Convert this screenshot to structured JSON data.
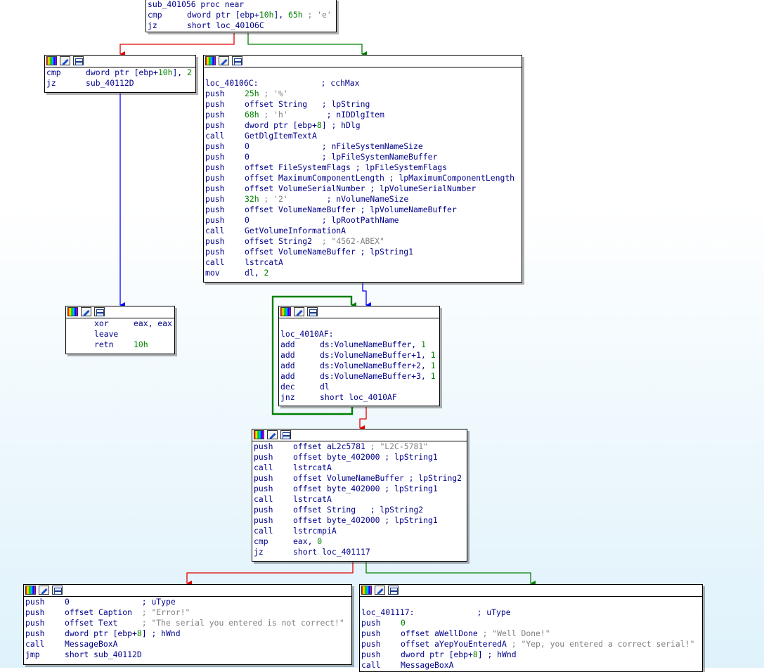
{
  "blocks": {
    "b1": {
      "lines": [
        {
          "label": "sub_401056 proc near"
        },
        {
          "mn": "cmp",
          "ops": "dword ptr [ebp+10h], 65h",
          "cmt": "; 'e'"
        },
        {
          "mn": "jz",
          "ops": "short loc_40106C"
        }
      ]
    },
    "b2": {
      "lines": [
        {
          "mn": "cmp",
          "ops": "dword ptr [ebp+10h], 2"
        },
        {
          "mn": "jz",
          "ops": "sub_40112D"
        }
      ]
    },
    "b3": {
      "lines": [
        {
          "label": "loc_40106C:             ; cchMax"
        },
        {
          "mn": "push",
          "ops": "25h",
          "cmt": "; '%'"
        },
        {
          "mn": "push",
          "ops": "offset String   ; lpString"
        },
        {
          "mn": "push",
          "ops": "68h",
          "cmt": "; 'h'",
          "tail": "        ; nIDDlgItem"
        },
        {
          "mn": "push",
          "ops": "dword ptr [ebp+8] ; hDlg"
        },
        {
          "mn": "call",
          "ops": "GetDlgItemTextA"
        },
        {
          "mn": "push",
          "ops": "0               ; nFileSystemNameSize"
        },
        {
          "mn": "push",
          "ops": "0               ; lpFileSystemNameBuffer"
        },
        {
          "mn": "push",
          "ops": "offset FileSystemFlags ; lpFileSystemFlags"
        },
        {
          "mn": "push",
          "ops": "offset MaximumComponentLength ; lpMaximumComponentLength"
        },
        {
          "mn": "push",
          "ops": "offset VolumeSerialNumber ; lpVolumeSerialNumber"
        },
        {
          "mn": "push",
          "ops": "32h",
          "cmt": "; '2'",
          "tail": "        ; nVolumeNameSize"
        },
        {
          "mn": "push",
          "ops": "offset VolumeNameBuffer ; lpVolumeNameBuffer"
        },
        {
          "mn": "push",
          "ops": "0               ; lpRootPathName"
        },
        {
          "mn": "call",
          "ops": "GetVolumeInformationA"
        },
        {
          "mn": "push",
          "ops": "offset String2  ",
          "cmt": "; \"4562-ABEX\""
        },
        {
          "mn": "push",
          "ops": "offset VolumeNameBuffer ; lpString1"
        },
        {
          "mn": "call",
          "ops": "lstrcatA"
        },
        {
          "mn": "mov",
          "ops": "dl, 2"
        }
      ]
    },
    "b4": {
      "lines": [
        {
          "mn": "xor",
          "ops": "eax, eax"
        },
        {
          "mn": "leave",
          "ops": ""
        },
        {
          "mn": "retn",
          "ops": "10h"
        }
      ]
    },
    "b5": {
      "lines": [
        {
          "label": "loc_4010AF:"
        },
        {
          "mn": "add",
          "ops": "ds:VolumeNameBuffer, 1"
        },
        {
          "mn": "add",
          "ops": "ds:VolumeNameBuffer+1, 1"
        },
        {
          "mn": "add",
          "ops": "ds:VolumeNameBuffer+2, 1"
        },
        {
          "mn": "add",
          "ops": "ds:VolumeNameBuffer+3, 1"
        },
        {
          "mn": "dec",
          "ops": "dl"
        },
        {
          "mn": "jnz",
          "ops": "short loc_4010AF"
        }
      ]
    },
    "b6": {
      "lines": [
        {
          "mn": "push",
          "ops": "offset aL2c5781 ",
          "cmt": "; \"L2C-5781\""
        },
        {
          "mn": "push",
          "ops": "offset byte_402000 ; lpString1"
        },
        {
          "mn": "call",
          "ops": "lstrcatA"
        },
        {
          "mn": "push",
          "ops": "offset VolumeNameBuffer ; lpString2"
        },
        {
          "mn": "push",
          "ops": "offset byte_402000 ; lpString1"
        },
        {
          "mn": "call",
          "ops": "lstrcatA"
        },
        {
          "mn": "push",
          "ops": "offset String   ; lpString2"
        },
        {
          "mn": "push",
          "ops": "offset byte_402000 ; lpString1"
        },
        {
          "mn": "call",
          "ops": "lstrcmpiA"
        },
        {
          "mn": "cmp",
          "ops": "eax, 0"
        },
        {
          "mn": "jz",
          "ops": "short loc_401117"
        }
      ]
    },
    "b7": {
      "lines": [
        {
          "mn": "push",
          "ops": "0               ; uType"
        },
        {
          "mn": "push",
          "ops": "offset Caption  ",
          "cmt": "; \"Error!\""
        },
        {
          "mn": "push",
          "ops": "offset Text     ",
          "cmt": "; \"The serial you entered is not correct!\""
        },
        {
          "mn": "push",
          "ops": "dword ptr [ebp+8] ; hWnd"
        },
        {
          "mn": "call",
          "ops": "MessageBoxA"
        },
        {
          "mn": "jmp",
          "ops": "short sub_40112D"
        }
      ]
    },
    "b8": {
      "lines": [
        {
          "label": "loc_401117:             ; uType"
        },
        {
          "mn": "push",
          "ops": "0"
        },
        {
          "mn": "push",
          "ops": "offset aWellDone ",
          "cmt": "; \"Well Done!\""
        },
        {
          "mn": "push",
          "ops": "offset aYepYouEnteredA ",
          "cmt": "; \"Yep, you entered a correct serial!\""
        },
        {
          "mn": "push",
          "ops": "dword ptr [ebp+8] ; hWnd"
        },
        {
          "mn": "call",
          "ops": "MessageBoxA"
        }
      ]
    }
  },
  "header_icons": [
    "color-palette-icon",
    "edit-pencil-icon",
    "graph-overview-icon"
  ],
  "colors": {
    "true_branch": "#008000",
    "false_branch": "#e00000",
    "jump": "#0000ff",
    "mnemonic": "#00008b",
    "comment": "#808080",
    "number": "#008000"
  }
}
